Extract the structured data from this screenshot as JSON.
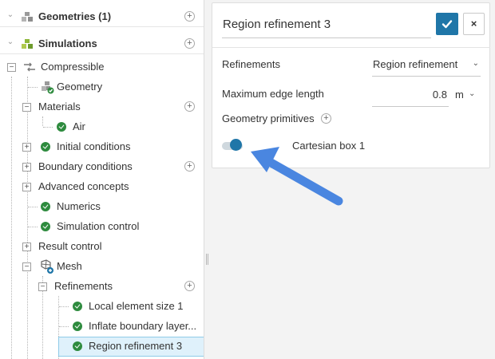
{
  "tree": {
    "geometries_label": "Geometries (1)",
    "simulations_label": "Simulations",
    "simulation_name": "Compressible",
    "geometry_label": "Geometry",
    "materials_label": "Materials",
    "air_label": "Air",
    "initial_conditions_label": "Initial conditions",
    "boundary_conditions_label": "Boundary conditions",
    "advanced_concepts_label": "Advanced concepts",
    "numerics_label": "Numerics",
    "simulation_control_label": "Simulation control",
    "result_control_label": "Result control",
    "mesh_label": "Mesh",
    "refinements_label": "Refinements",
    "refinement_items": [
      "Local element size 1",
      "Inflate boundary layer...",
      "Region refinement 3"
    ],
    "plus_symbol": "+",
    "minus_symbol": "−"
  },
  "form": {
    "title_value": "Region refinement 3",
    "cancel_symbol": "×",
    "refinements_label": "Refinements",
    "refinement_type_value": "Region refinement",
    "max_edge_label": "Maximum edge length",
    "max_edge_value": "0.8",
    "unit_value": "m",
    "geometry_primitives_label": "Geometry primitives",
    "primitive_name": "Cartesian box 1",
    "primitive_enabled": true
  },
  "colors": {
    "accent": "#1f76a8",
    "check_green": "#2e8b3e",
    "arrow_blue": "#4a86e0",
    "selected_bg": "#dff1fb"
  },
  "icons": {
    "chevron_down": "⌄",
    "chevron_right": "›",
    "select_chevron": "⌄"
  }
}
